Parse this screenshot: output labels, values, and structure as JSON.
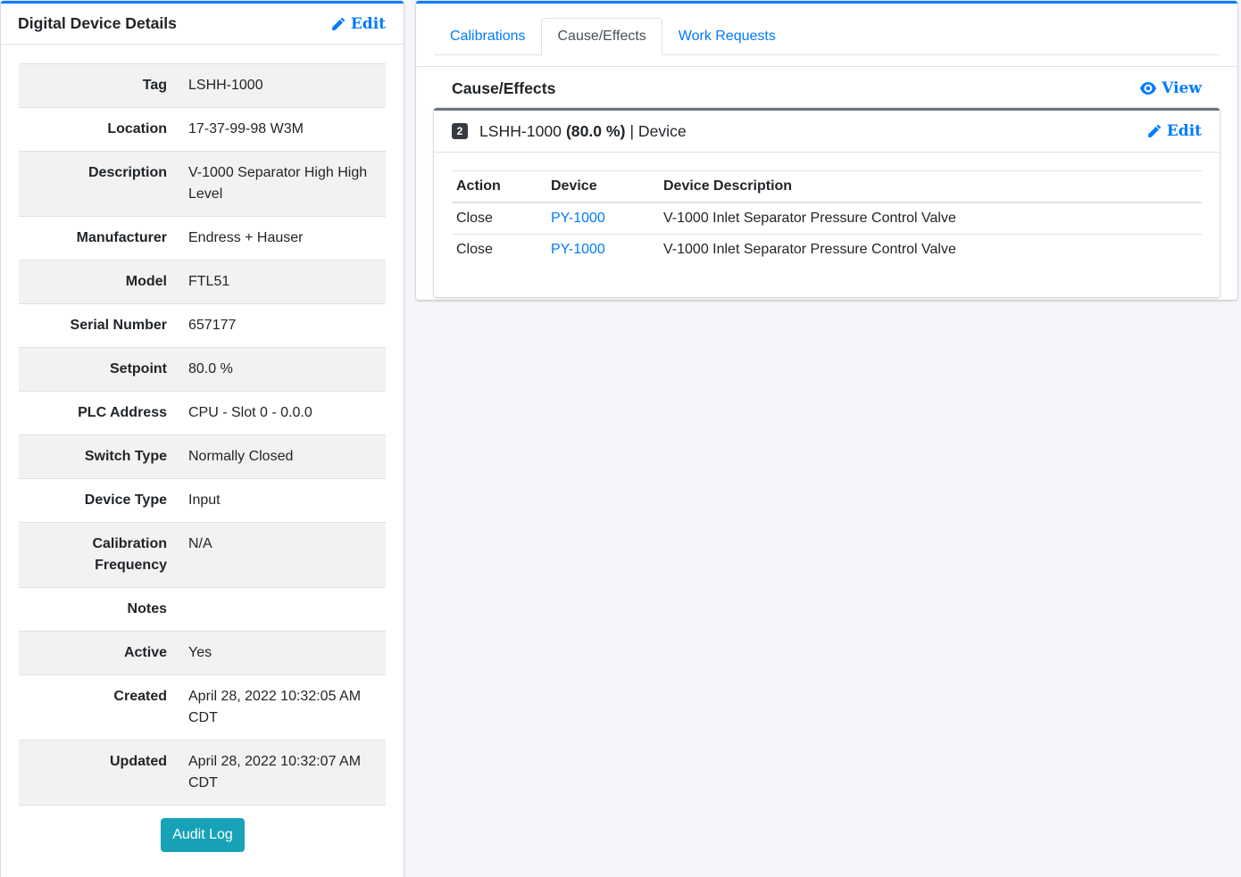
{
  "device_panel": {
    "title": "Digital Device Details",
    "edit_label": "Edit",
    "fields": [
      {
        "label": "Tag",
        "value": "LSHH-1000"
      },
      {
        "label": "Location",
        "value": "17-37-99-98 W3M"
      },
      {
        "label": "Description",
        "value": "V-1000 Separator High High Level"
      },
      {
        "label": "Manufacturer",
        "value": "Endress + Hauser"
      },
      {
        "label": "Model",
        "value": "FTL51"
      },
      {
        "label": "Serial Number",
        "value": "657177"
      },
      {
        "label": "Setpoint",
        "value": "80.0 %"
      },
      {
        "label": "PLC Address",
        "value": "CPU - Slot 0 - 0.0.0"
      },
      {
        "label": "Switch Type",
        "value": "Normally Closed"
      },
      {
        "label": "Device Type",
        "value": "Input"
      },
      {
        "label": "Calibration Frequency",
        "value": "N/A"
      },
      {
        "label": "Notes",
        "value": ""
      },
      {
        "label": "Active",
        "value": "Yes"
      },
      {
        "label": "Created",
        "value": "April 28, 2022 10:32:05 AM CDT"
      },
      {
        "label": "Updated",
        "value": "April 28, 2022 10:32:07 AM CDT"
      }
    ],
    "audit_log_label": "Audit Log"
  },
  "tabs": [
    {
      "label": "Calibrations",
      "active": false
    },
    {
      "label": "Cause/Effects",
      "active": true
    },
    {
      "label": "Work Requests",
      "active": false
    }
  ],
  "cause_effects": {
    "title": "Cause/Effects",
    "view_label": "View",
    "cause": {
      "badge": "2",
      "tag": "LSHH-1000",
      "setpoint": "(80.0 %)",
      "suffix": "| Device",
      "edit_label": "Edit"
    },
    "columns": [
      "Action",
      "Device",
      "Device Description"
    ],
    "rows": [
      {
        "action": "Close",
        "device": "PY-1000",
        "description": "V-1000 Inlet Separator Pressure Control Valve"
      },
      {
        "action": "Close",
        "device": "PY-1000",
        "description": "V-1000 Inlet Separator Pressure Control Valve"
      }
    ]
  },
  "colors": {
    "primary": "#007bff",
    "info": "#17a2b8",
    "badge": "#343a40"
  }
}
